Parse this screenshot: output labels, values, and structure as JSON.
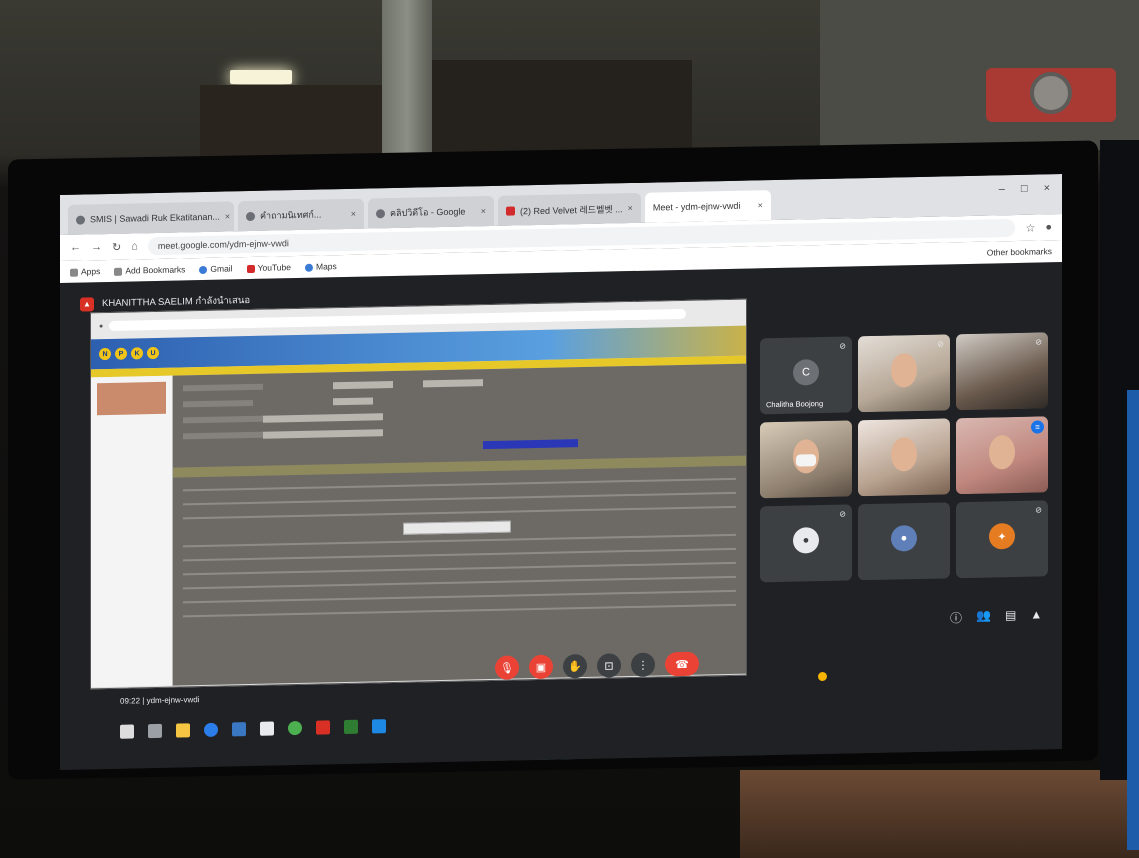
{
  "browser": {
    "tabs": [
      {
        "label": "SMIS | Sawadi Ruk Ekatitanan..."
      },
      {
        "label": "คำถามนิเทศก์..."
      },
      {
        "label": "คลิปวิดีโอ - Google"
      },
      {
        "label": "(2) Red Velvet 레드벨벳 ..."
      },
      {
        "label": "Meet - ydm-ejnw-vwdi"
      }
    ],
    "window_controls": [
      "–",
      "□",
      "×"
    ],
    "url": "meet.google.com/ydm-ejnw-vwdi",
    "bookmarks": [
      "Apps",
      "Add Bookmarks",
      "Gmail",
      "YouTube",
      "Maps",
      "Other bookmarks"
    ]
  },
  "meet": {
    "presenter": "KHANITTHA SAELIM กำลังนำเสนอ",
    "meeting_code": "ydm-ejnw-vwdi",
    "time": "09:22",
    "tiles": [
      {
        "name": "Chalitha Boojong",
        "initial": "C",
        "type": "avatar"
      },
      {
        "name": "",
        "type": "video"
      },
      {
        "name": "",
        "type": "video"
      },
      {
        "name": "",
        "type": "video"
      },
      {
        "name": "",
        "type": "video"
      },
      {
        "name": "",
        "type": "video"
      },
      {
        "name": "",
        "type": "avatar"
      },
      {
        "name": "",
        "type": "avatar"
      },
      {
        "name": "",
        "type": "avatar"
      }
    ],
    "weather": "",
    "tray": ""
  },
  "shared_screen": {
    "banner_letters": [
      "N",
      "P",
      "K",
      "U"
    ],
    "tooltip": ""
  },
  "colors": {
    "meet_bg": "#202124",
    "tile_bg": "#3c4043",
    "end_call": "#ea4335",
    "banner_blue": "#2d5fb0"
  }
}
